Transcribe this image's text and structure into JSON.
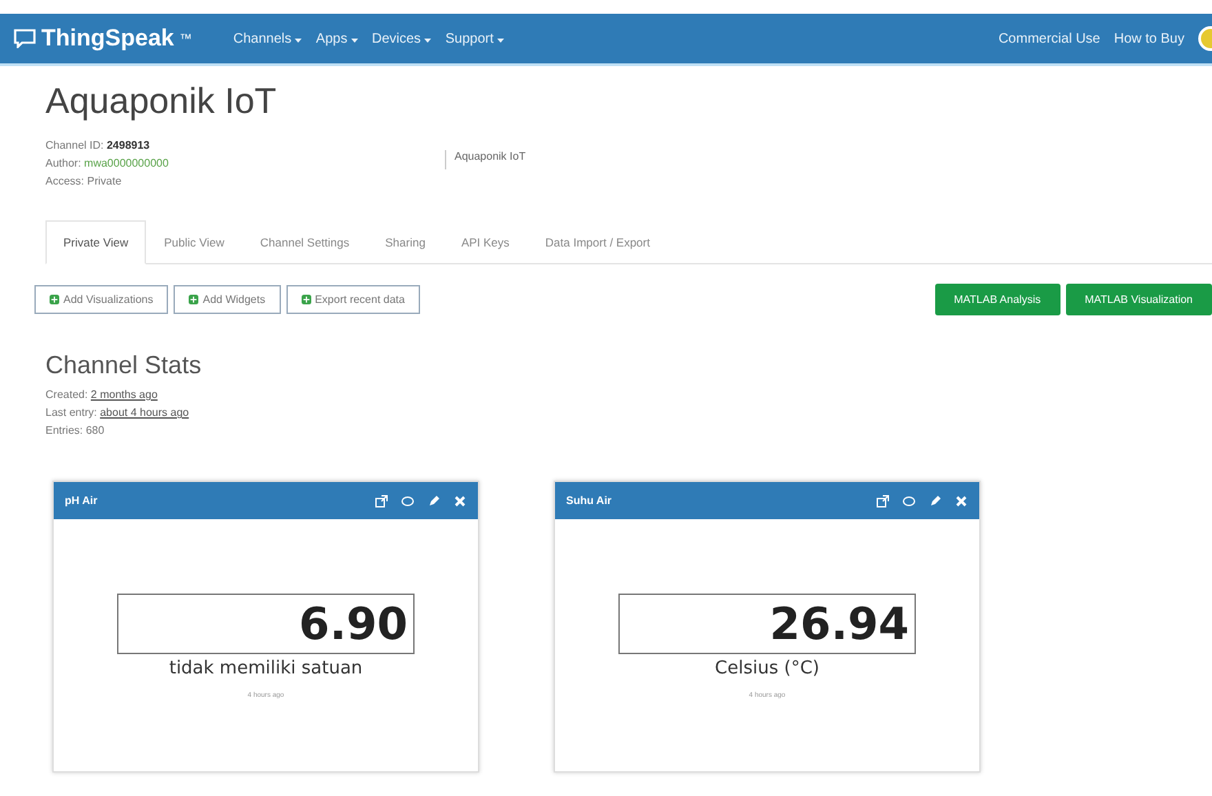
{
  "navbar": {
    "logo": "ThingSpeak",
    "logo_mark": "™",
    "menus": [
      "Channels",
      "Apps",
      "Devices",
      "Support"
    ],
    "links": [
      "Commercial Use",
      "How to Buy"
    ]
  },
  "channel": {
    "title": "Aquaponik IoT",
    "id_label": "Channel ID:",
    "id": "2498913",
    "author_label": "Author:",
    "author": "mwa0000000000",
    "access_label": "Access:",
    "access": "Private",
    "description": "Aquaponik IoT"
  },
  "tabs": [
    {
      "label": "Private View",
      "selected": true
    },
    {
      "label": "Public View",
      "selected": false
    },
    {
      "label": "Channel Settings",
      "selected": false
    },
    {
      "label": "Sharing",
      "selected": false
    },
    {
      "label": "API Keys",
      "selected": false
    },
    {
      "label": "Data Import / Export",
      "selected": false
    }
  ],
  "actions": [
    "Add Visualizations",
    "Add Widgets",
    "Export recent data"
  ],
  "matlab_buttons": [
    "MATLAB Analysis",
    "MATLAB Visualization"
  ],
  "stats": {
    "title": "Channel Stats",
    "created_label": "Created:",
    "created": "2 months ago",
    "last_entry_label": "Last entry:",
    "last_entry": "about 4 hours ago",
    "entries_label": "Entries:",
    "entries": "680"
  },
  "widgets": [
    {
      "title": "pH Air",
      "value": "6.90",
      "unit": "tidak memiliki satuan",
      "updated": "4 hours ago"
    },
    {
      "title": "Suhu Air",
      "value": "26.94",
      "unit": "Celsius (°C)",
      "updated": "4 hours ago"
    }
  ]
}
